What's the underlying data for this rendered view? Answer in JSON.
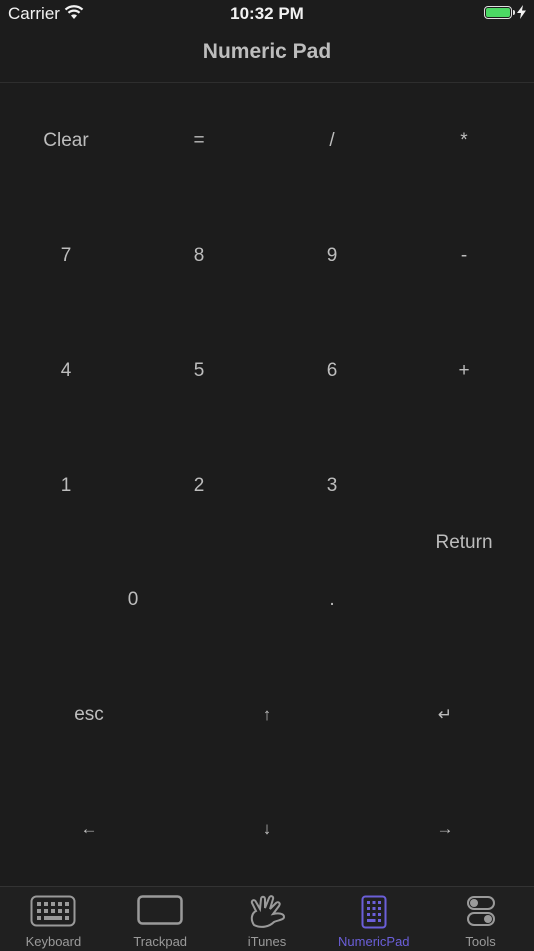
{
  "status_bar": {
    "carrier": "Carrier",
    "time": "10:32 PM",
    "battery_level": 1.0,
    "battery_color": "#4cd964"
  },
  "nav": {
    "title": "Numeric Pad"
  },
  "keypad": {
    "row1": [
      "Clear",
      "=",
      "/",
      "*"
    ],
    "row2": [
      "7",
      "8",
      "9",
      "-"
    ],
    "row3": [
      "4",
      "5",
      "6",
      "+"
    ],
    "row4": [
      "1",
      "2",
      "3"
    ],
    "return_label": "Return",
    "row5": [
      "0",
      "."
    ],
    "arrows": {
      "esc": "esc",
      "up": "↑",
      "enter": "↵",
      "left": "←",
      "down": "↓",
      "right": "→"
    }
  },
  "tab_bar": {
    "accent_color": "#6b5fd9",
    "tabs": [
      {
        "label": "Keyboard",
        "icon": "keyboard-icon"
      },
      {
        "label": "Trackpad",
        "icon": "trackpad-icon"
      },
      {
        "label": "iTunes",
        "icon": "itunes-icon"
      },
      {
        "label": "NumericPad",
        "icon": "numericpad-icon",
        "active": true
      },
      {
        "label": "Tools",
        "icon": "tools-icon"
      }
    ]
  }
}
